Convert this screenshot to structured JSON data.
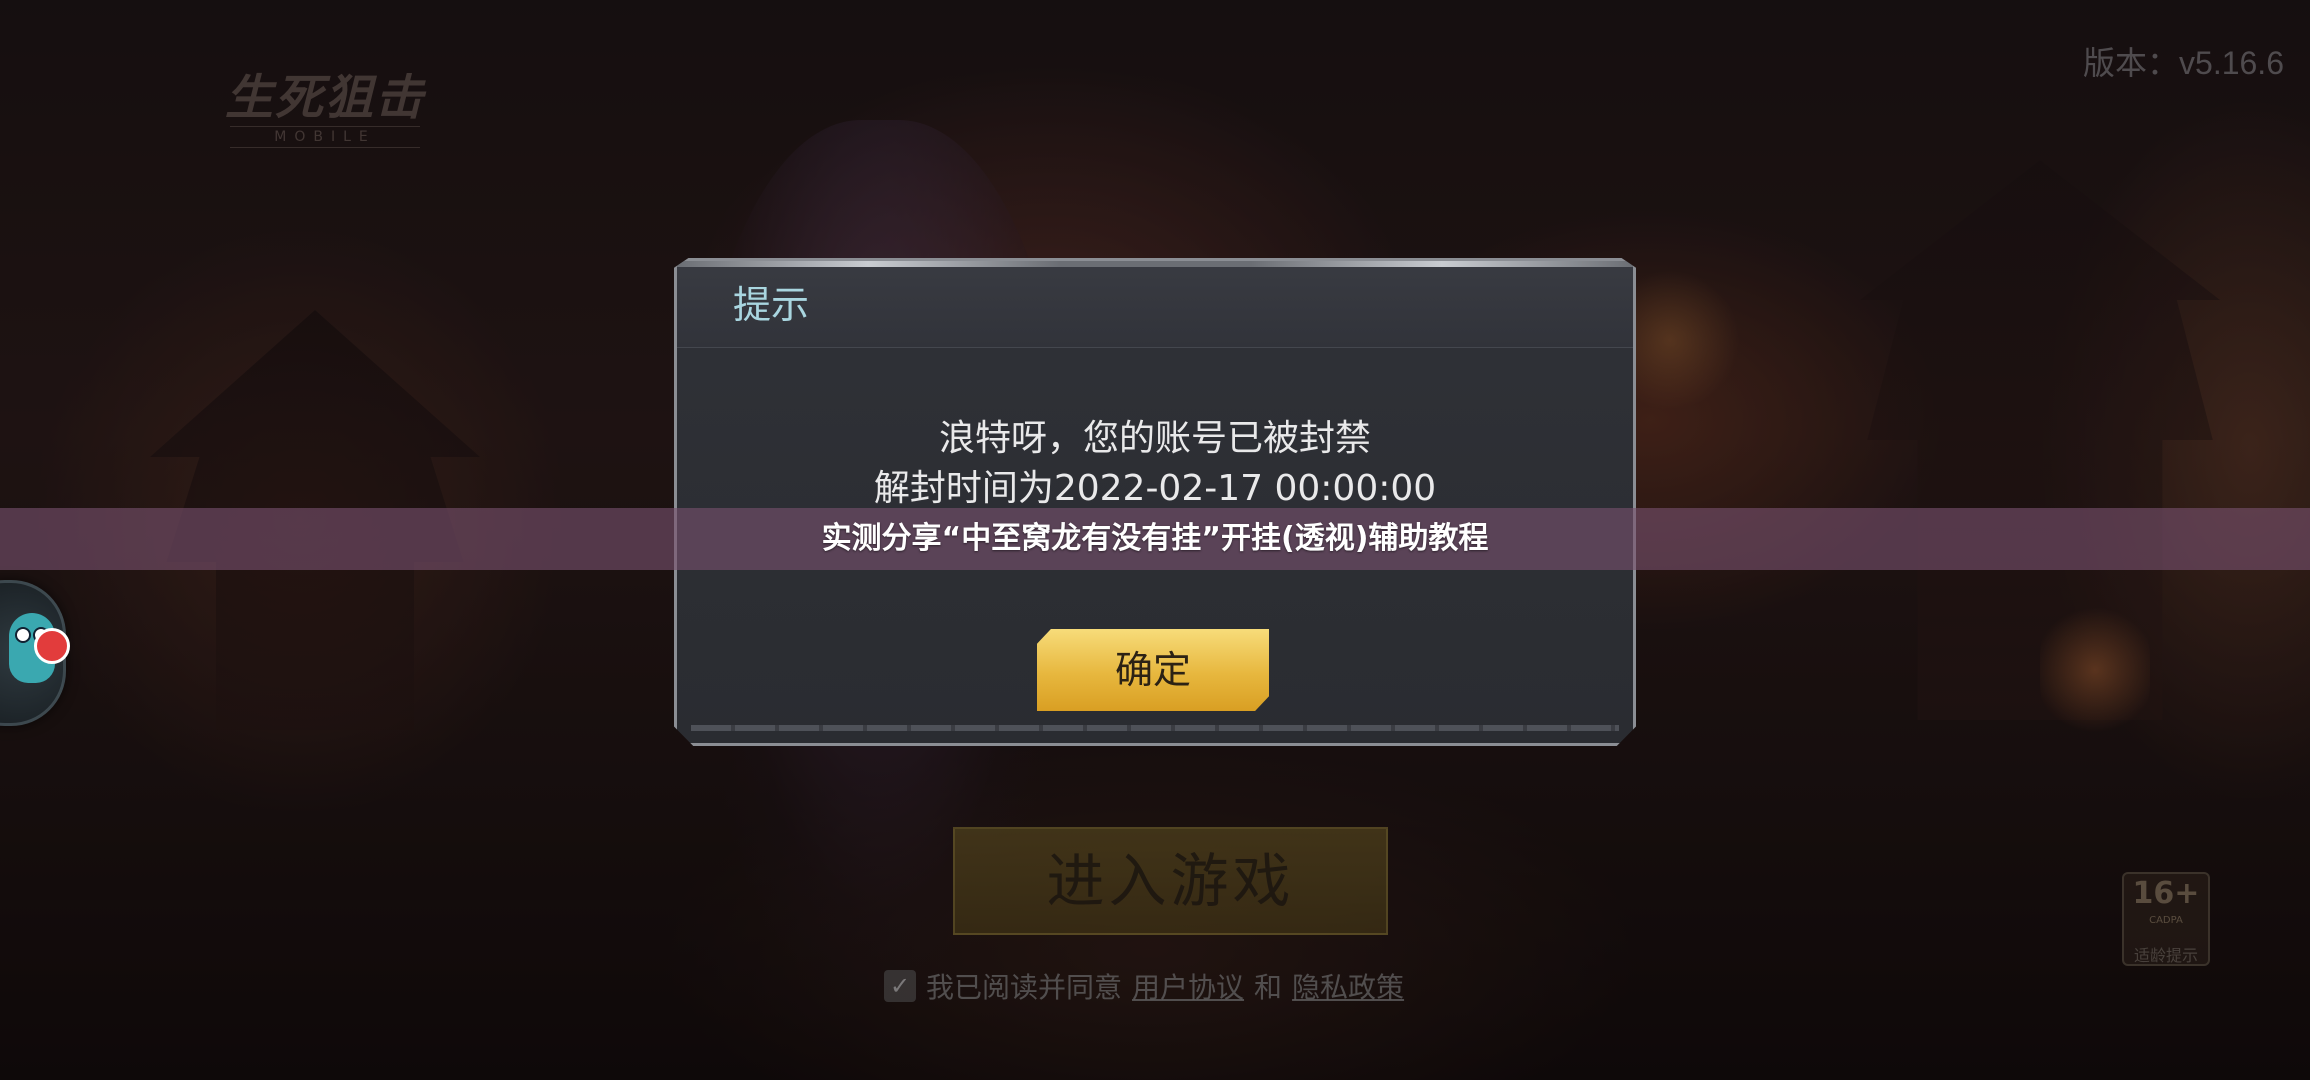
{
  "game": {
    "logo_main": "生死狙击",
    "logo_sub": "MOBILE",
    "version": "版本：v5.16.6"
  },
  "dialog": {
    "title": "提示",
    "message_line_1": "浪特呀，您的账号已被封禁",
    "message_line_2": "解封时间为2022-02-17 00:00:00",
    "message_line_3": "",
    "confirm_label": "确定"
  },
  "main": {
    "enter_game_label": "进入游戏",
    "agreement": {
      "checked_glyph": "✓",
      "prefix": "我已阅读并同意",
      "user_agreement": "用户协议",
      "and": "和",
      "privacy_policy": "隐私政策"
    },
    "age_rating": {
      "value": "16+",
      "sub": "CADPA",
      "caption": "适龄提示"
    }
  },
  "banner": {
    "title": "实测分享“中至窝龙有没有挂”开挂(透视)辅助教程"
  },
  "colors": {
    "dialog_title": "#a9d6e0",
    "confirm_button": "#e7b73e",
    "banner_bg": "#784e6e",
    "notify_dot": "#e23c3c"
  },
  "icons": {
    "assistant": "floating-assistant-icon",
    "notification": "notification-dot-icon",
    "checkbox": "checkbox-checked-icon"
  }
}
